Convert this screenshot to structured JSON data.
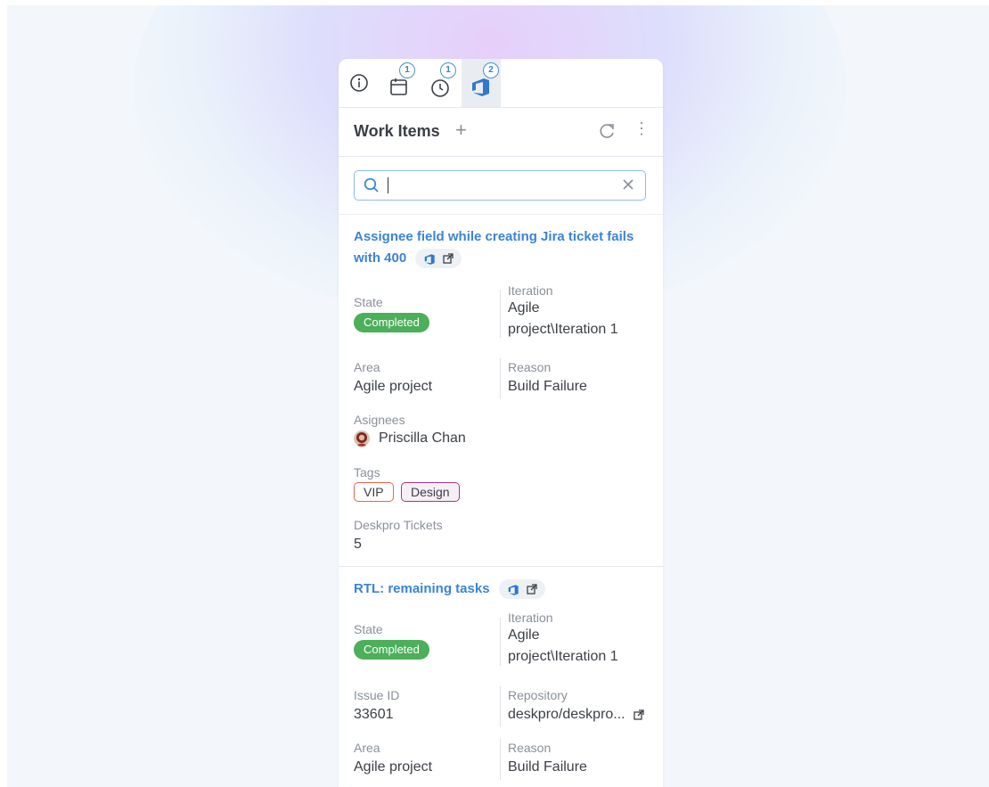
{
  "tabs": [
    {
      "name": "info",
      "badge": ""
    },
    {
      "name": "calendar",
      "badge": "1"
    },
    {
      "name": "clock",
      "badge": "1"
    },
    {
      "name": "work-items",
      "badge": "2"
    }
  ],
  "header": {
    "title": "Work Items",
    "plus": "+",
    "menu": "⋮"
  },
  "search": {
    "value": "",
    "placeholder": ""
  },
  "items": [
    {
      "title_line1": "Assignee field while creating  Jira ticket fails",
      "title_line2": "with 400",
      "state_label": "State",
      "state": "Completed",
      "iteration_label": "Iteration",
      "iteration_line1": "Agile",
      "iteration_line2": "project\\Iteration 1",
      "area_label": "Area",
      "area": "Agile project",
      "reason_label": "Reason",
      "reason": "Build Failure",
      "assignees_label": "Asignees",
      "assignee": "Priscilla Chan",
      "tags_label": "Tags",
      "tags": [
        {
          "text": "VIP",
          "color": "#e0664b"
        },
        {
          "text": "Design",
          "color": "#9b3a8c"
        }
      ],
      "tickets_label": "Deskpro Tickets",
      "tickets": "5"
    },
    {
      "title": "RTL: remaining tasks",
      "state_label": "State",
      "state": "Completed",
      "iteration_label": "Iteration",
      "iteration_line1": "Agile",
      "iteration_line2": "project\\Iteration 1",
      "issue_id_label": "Issue ID",
      "issue_id": "33601",
      "repository_label": "Repository",
      "repository": "deskpro/deskpro...",
      "area_label": "Area",
      "area": "Agile project",
      "reason_label": "Reason",
      "reason": "Build Failure"
    }
  ],
  "colors": {
    "accent": "#3b84d4",
    "completed": "#4caf5a",
    "tag_vip": "#e0664b",
    "tag_design": "#9b3a8c"
  }
}
